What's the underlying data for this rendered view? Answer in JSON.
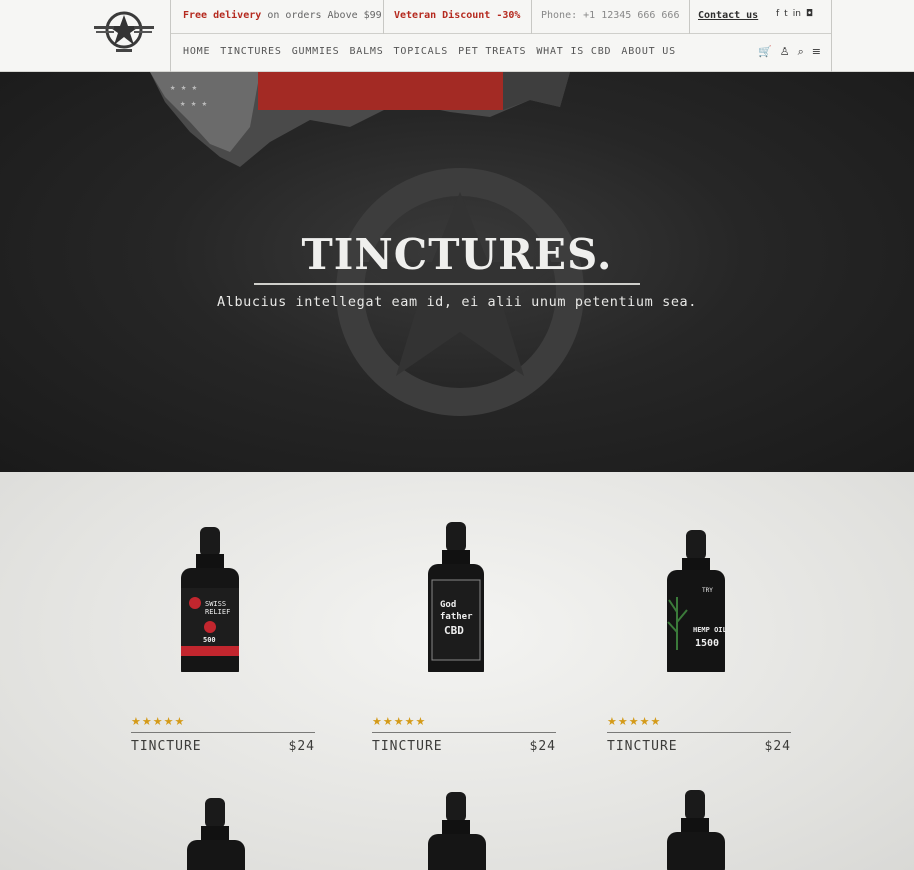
{
  "topbar": {
    "free_delivery": "Free delivery",
    "free_delivery_suffix": "on orders Above $99",
    "veteran_discount": "Veteran Discount -30%",
    "phone": "Phone: +1 12345 666 666",
    "contact": "Contact us",
    "social_icons": [
      "facebook-icon",
      "twitter-icon",
      "linkedin-icon",
      "instagram-icon"
    ]
  },
  "nav": {
    "items": [
      "HOME",
      "TINCTURES",
      "GUMMIES",
      "BALMS",
      "TOPICALS",
      "PET TREATS",
      "WHAT IS CBD",
      "ABOUT US"
    ],
    "icons": [
      "cart-icon",
      "user-icon",
      "search-icon",
      "menu-icon"
    ]
  },
  "hero": {
    "title": "TINCTURES.",
    "subtitle": "Albucius intellegat eam id, ei alii unum petentium sea."
  },
  "products": [
    {
      "name": "TINCTURE",
      "price": "$24",
      "rating": 5,
      "label": "SWISS RELIEF",
      "label_sub": "500",
      "label_color": "#c2262e"
    },
    {
      "name": "TINCTURE",
      "price": "$24",
      "rating": 5,
      "label": "Godfather CBD",
      "label_sub": "",
      "label_color": "#e9e9e9"
    },
    {
      "name": "TINCTURE",
      "price": "$24",
      "rating": 5,
      "label": "HEMP OIL",
      "label_sub": "1500",
      "label_color": "#3b7a3a"
    }
  ],
  "colors": {
    "accent": "#b52a1f",
    "star": "#d49a18",
    "hero_bg": "#262626"
  }
}
